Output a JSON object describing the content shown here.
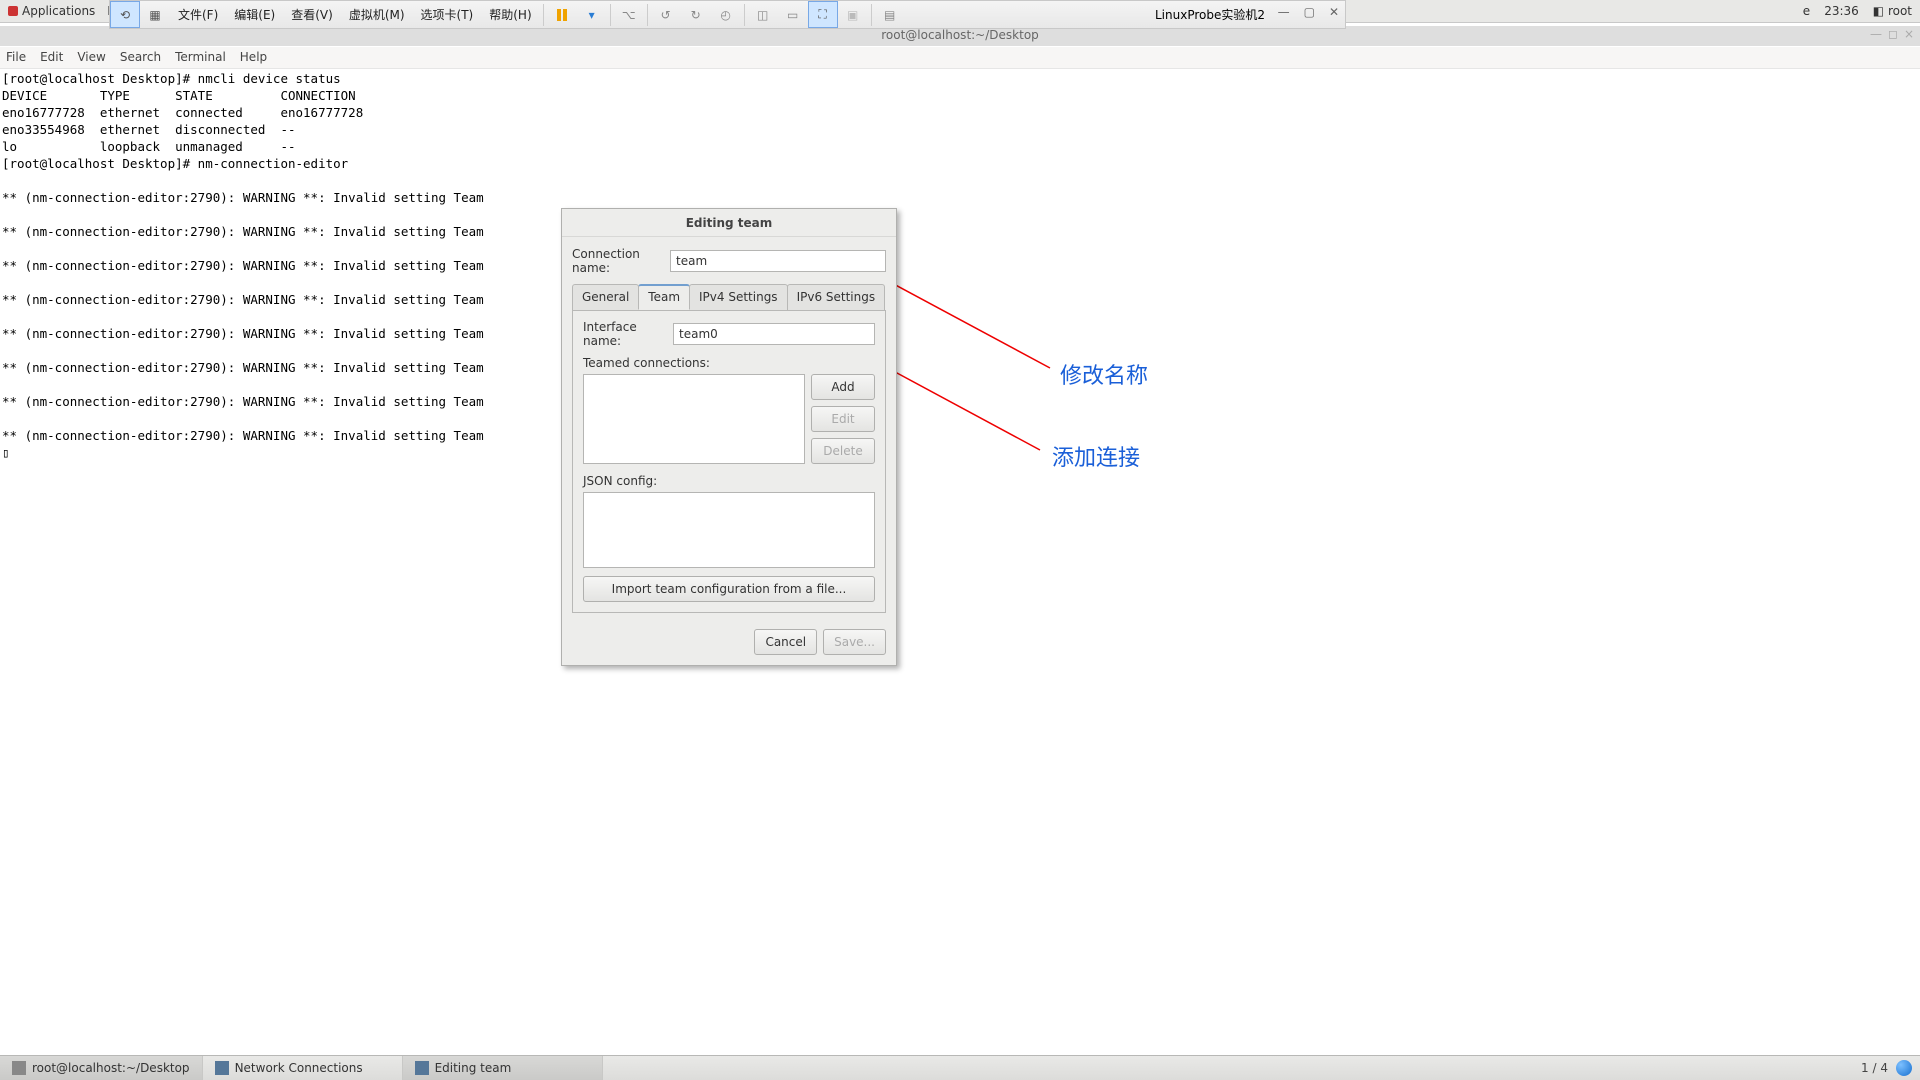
{
  "gnome": {
    "apps": "Applications",
    "places": "Pl",
    "time": "23:36",
    "user": "root",
    "date_trunc": "e"
  },
  "vm": {
    "menus": [
      "文件(F)",
      "编辑(E)",
      "查看(V)",
      "虚拟机(M)",
      "选项卡(T)",
      "帮助(H)"
    ],
    "title": "LinuxProbe实验机2"
  },
  "term_title": "root@localhost:~/Desktop",
  "term_menus": [
    "File",
    "Edit",
    "View",
    "Search",
    "Terminal",
    "Help"
  ],
  "term_body": "[root@localhost Desktop]# nmcli device status\nDEVICE       TYPE      STATE         CONNECTION  \neno16777728  ethernet  connected     eno16777728 \neno33554968  ethernet  disconnected  --          \nlo           loopback  unmanaged     --          \n[root@localhost Desktop]# nm-connection-editor\n\n** (nm-connection-editor:2790): WARNING **: Invalid setting Team\n\n** (nm-connection-editor:2790): WARNING **: Invalid setting Team\n\n** (nm-connection-editor:2790): WARNING **: Invalid setting Team\n\n** (nm-connection-editor:2790): WARNING **: Invalid setting Team\n\n** (nm-connection-editor:2790): WARNING **: Invalid setting Team\n\n** (nm-connection-editor:2790): WARNING **: Invalid setting Team\n\n** (nm-connection-editor:2790): WARNING **: Invalid setting Team\n\n** (nm-connection-editor:2790): WARNING **: Invalid setting Team\n▯",
  "dialog": {
    "title": "Editing team",
    "conn_label": "Connection name:",
    "conn_value": "team",
    "tabs": [
      "General",
      "Team",
      "IPv4 Settings",
      "IPv6 Settings"
    ],
    "iface_label": "Interface name:",
    "iface_value": "team0",
    "teamed_label": "Teamed connections:",
    "add": "Add",
    "edit": "Edit",
    "delete": "Delete",
    "json_label": "JSON config:",
    "import": "Import team configuration from a file...",
    "cancel": "Cancel",
    "save": "Save..."
  },
  "anno": {
    "a1": "修改名称",
    "a2": "添加连接"
  },
  "taskbar": {
    "t1": "root@localhost:~/Desktop",
    "t2": "Network Connections",
    "t3": "Editing team",
    "counter": "1 / 4"
  }
}
